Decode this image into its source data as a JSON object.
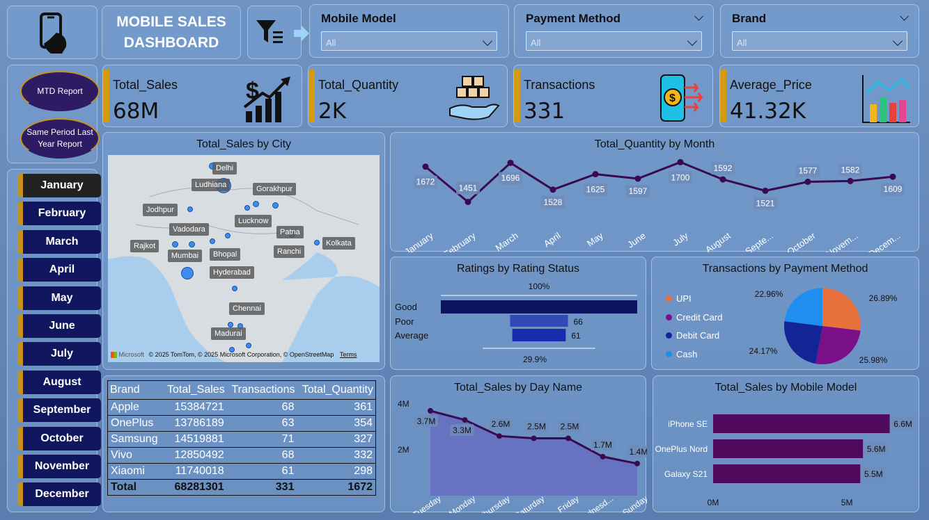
{
  "header": {
    "title_line1": "MOBILE SALES",
    "title_line2": "DASHBOARD"
  },
  "slicers": [
    {
      "label": "Mobile Model",
      "value": "All"
    },
    {
      "label": "Payment Method",
      "value": "All"
    },
    {
      "label": "Brand",
      "value": "All"
    }
  ],
  "kpis": [
    {
      "label": "Total_Sales",
      "value": "68M"
    },
    {
      "label": "Total_Quantity",
      "value": "2K"
    },
    {
      "label": "Transactions",
      "value": "331"
    },
    {
      "label": "Average_Price",
      "value": "41.32K"
    }
  ],
  "reports": {
    "mtd": "MTD Report",
    "same_period": "Same Period Last Year Report"
  },
  "months": [
    "January",
    "February",
    "March",
    "April",
    "May",
    "June",
    "July",
    "August",
    "September",
    "October",
    "November",
    "December"
  ],
  "active_month": "January",
  "map": {
    "title": "Total_Sales by City",
    "cities": [
      "Delhi",
      "Ludhiana",
      "Gorakhpur",
      "Jodhpur",
      "Lucknow",
      "Vadodara",
      "Patna",
      "Rajkot",
      "Bhopal",
      "Ranchi",
      "Kolkata",
      "Mumbai",
      "Hyderabad",
      "Chennai",
      "Madurai"
    ],
    "attribution": "© 2025 TomTom, © 2025 Microsoft Corporation, © OpenStreetMap",
    "terms": "Terms",
    "brand": "Microsoft"
  },
  "table": {
    "headers": [
      "Brand",
      "Total_Sales",
      "Transactions",
      "Total_Quantity"
    ],
    "rows": [
      [
        "Apple",
        "15384721",
        "68",
        "361"
      ],
      [
        "OnePlus",
        "13786189",
        "63",
        "354"
      ],
      [
        "Samsung",
        "14519881",
        "71",
        "327"
      ],
      [
        "Vivo",
        "12850492",
        "68",
        "332"
      ],
      [
        "Xiaomi",
        "11740018",
        "61",
        "298"
      ]
    ],
    "total": [
      "Total",
      "68281301",
      "331",
      "1672"
    ]
  },
  "colors": {
    "accent": "#d49a12",
    "month_button": "#10175f",
    "line": "#3a0a4f",
    "bar_purple": "#4f0a5e",
    "bar_navy": "#0d1560",
    "upi": "#e8703a",
    "credit": "#7a0f8a",
    "debit": "#132496",
    "cash": "#1e8ff0"
  },
  "chart_data": [
    {
      "type": "line",
      "title": "Total_Quantity by Month",
      "categories": [
        "January",
        "February",
        "March",
        "April",
        "May",
        "June",
        "July",
        "August",
        "Septe...",
        "October",
        "Novem...",
        "Decem..."
      ],
      "values": [
        1672,
        1451,
        1696,
        1528,
        1625,
        1597,
        1700,
        1592,
        1521,
        1577,
        1582,
        1609
      ],
      "labels": [
        "1672",
        "1451",
        "1696",
        "1528",
        "1625",
        "1597",
        "1700",
        "1592",
        "1521",
        "1577",
        "1582",
        "1609"
      ]
    },
    {
      "type": "bar",
      "title": "Ratings by Rating Status",
      "categories": [
        "Good",
        "Poor",
        "Average"
      ],
      "values": [
        204,
        66,
        61
      ],
      "top_label": "100%",
      "bottom_label": "29.9%"
    },
    {
      "type": "pie",
      "title": "Transactions by Payment Method",
      "legend": [
        "UPI",
        "Credit Card",
        "Debit Card",
        "Cash"
      ],
      "values": [
        26.89,
        25.98,
        24.17,
        22.96
      ],
      "labels": [
        "26.89%",
        "25.98%",
        "24.17%",
        "22.96%"
      ],
      "legend_position": "left"
    },
    {
      "type": "area",
      "title": "Total_Sales by Day Name",
      "categories": [
        "Tuesday",
        "Monday",
        "Thursday",
        "Saturday",
        "Friday",
        "Wednesd...",
        "Sunday"
      ],
      "values": [
        3.7,
        3.3,
        2.6,
        2.5,
        2.5,
        1.7,
        1.4
      ],
      "labels": [
        "3.7M",
        "3.3M",
        "2.6M",
        "2.5M",
        "2.5M",
        "1.7M",
        "1.4M"
      ],
      "yticks": [
        "4M",
        "2M"
      ],
      "ylim": [
        0,
        4
      ]
    },
    {
      "type": "bar",
      "title": "Total_Sales by Mobile Model",
      "categories": [
        "iPhone SE",
        "OnePlus Nord",
        "Galaxy S21"
      ],
      "values": [
        6.6,
        5.6,
        5.5
      ],
      "labels": [
        "6.6M",
        "5.6M",
        "5.5M"
      ],
      "xticks": [
        "0M",
        "5M"
      ],
      "xlim": [
        0,
        7.6
      ]
    }
  ]
}
